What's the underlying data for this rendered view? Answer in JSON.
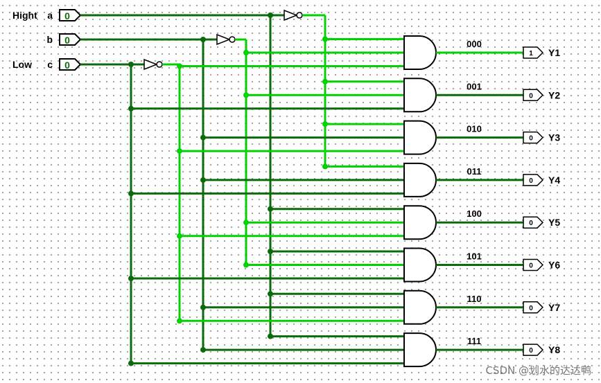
{
  "colors": {
    "wire_low": "#0b6b0b",
    "wire_high": "#00d200",
    "gate": "#000000",
    "pin_label": "#8080ff"
  },
  "inputs": [
    {
      "side_label": "Hight",
      "name": "a",
      "value": "0"
    },
    {
      "side_label": "",
      "name": "b",
      "value": "0"
    },
    {
      "side_label": "Low",
      "name": "c",
      "value": "0"
    }
  ],
  "outputs": [
    {
      "code": "000",
      "name": "Y1",
      "value": "1"
    },
    {
      "code": "001",
      "name": "Y2",
      "value": "0"
    },
    {
      "code": "010",
      "name": "Y3",
      "value": "0"
    },
    {
      "code": "011",
      "name": "Y4",
      "value": "0"
    },
    {
      "code": "100",
      "name": "Y5",
      "value": "0"
    },
    {
      "code": "101",
      "name": "Y6",
      "value": "0"
    },
    {
      "code": "110",
      "name": "Y7",
      "value": "0"
    },
    {
      "code": "111",
      "name": "Y8",
      "value": "0"
    }
  ],
  "watermark": "CSDN @划水的达达鸭"
}
